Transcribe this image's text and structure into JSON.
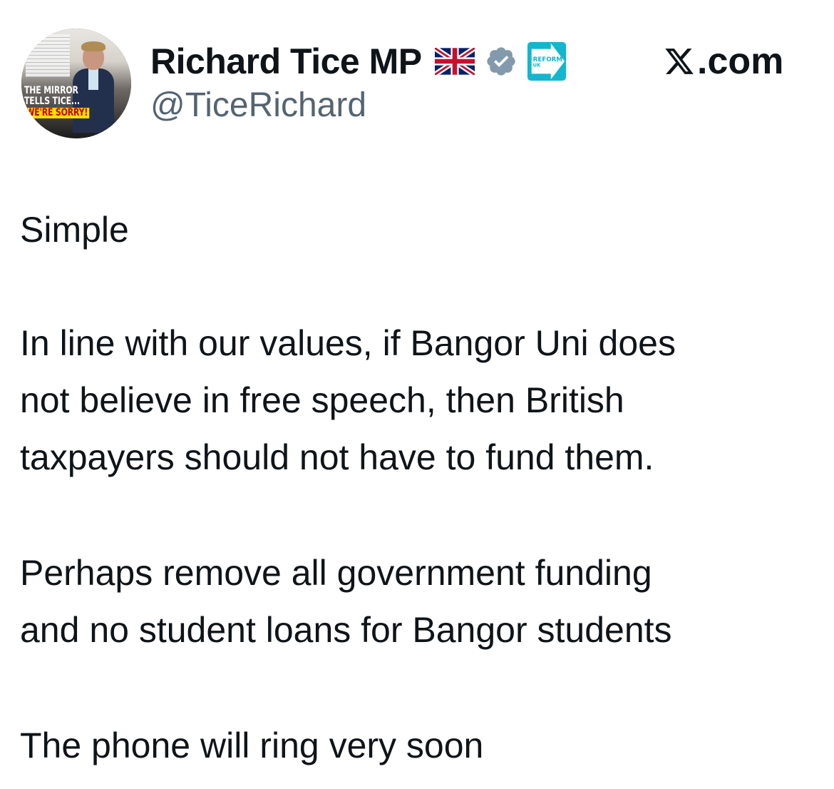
{
  "author": {
    "display_name": "Richard Tice MP",
    "handle": "@TiceRichard",
    "avatar_caption": {
      "line1": "THE MIRROR",
      "line2": "TELLS TICE...",
      "line3": "WE'RE SORRY!"
    },
    "badges": {
      "flag_icon": "uk-flag-icon",
      "verified_icon": "verified-badge-icon",
      "affiliation_icon": "reform-uk-badge-icon",
      "affiliation_text_1": "REFORM",
      "affiliation_text_2": "UK",
      "verified_color": "#829aab"
    }
  },
  "source": {
    "label": ".com",
    "logo_icon": "x-logo-icon"
  },
  "tweet": {
    "para1": "Simple",
    "para2": [
      "In line with our values, if Bangor Uni does",
      "not believe in free speech, then British",
      "taxpayers should not have to fund them."
    ],
    "para3": [
      "Perhaps remove all government funding",
      "and no student loans for Bangor students"
    ],
    "para4": "The phone will ring very soon"
  },
  "colors": {
    "text": "#0f1419",
    "secondary": "#536471",
    "background": "#ffffff"
  }
}
